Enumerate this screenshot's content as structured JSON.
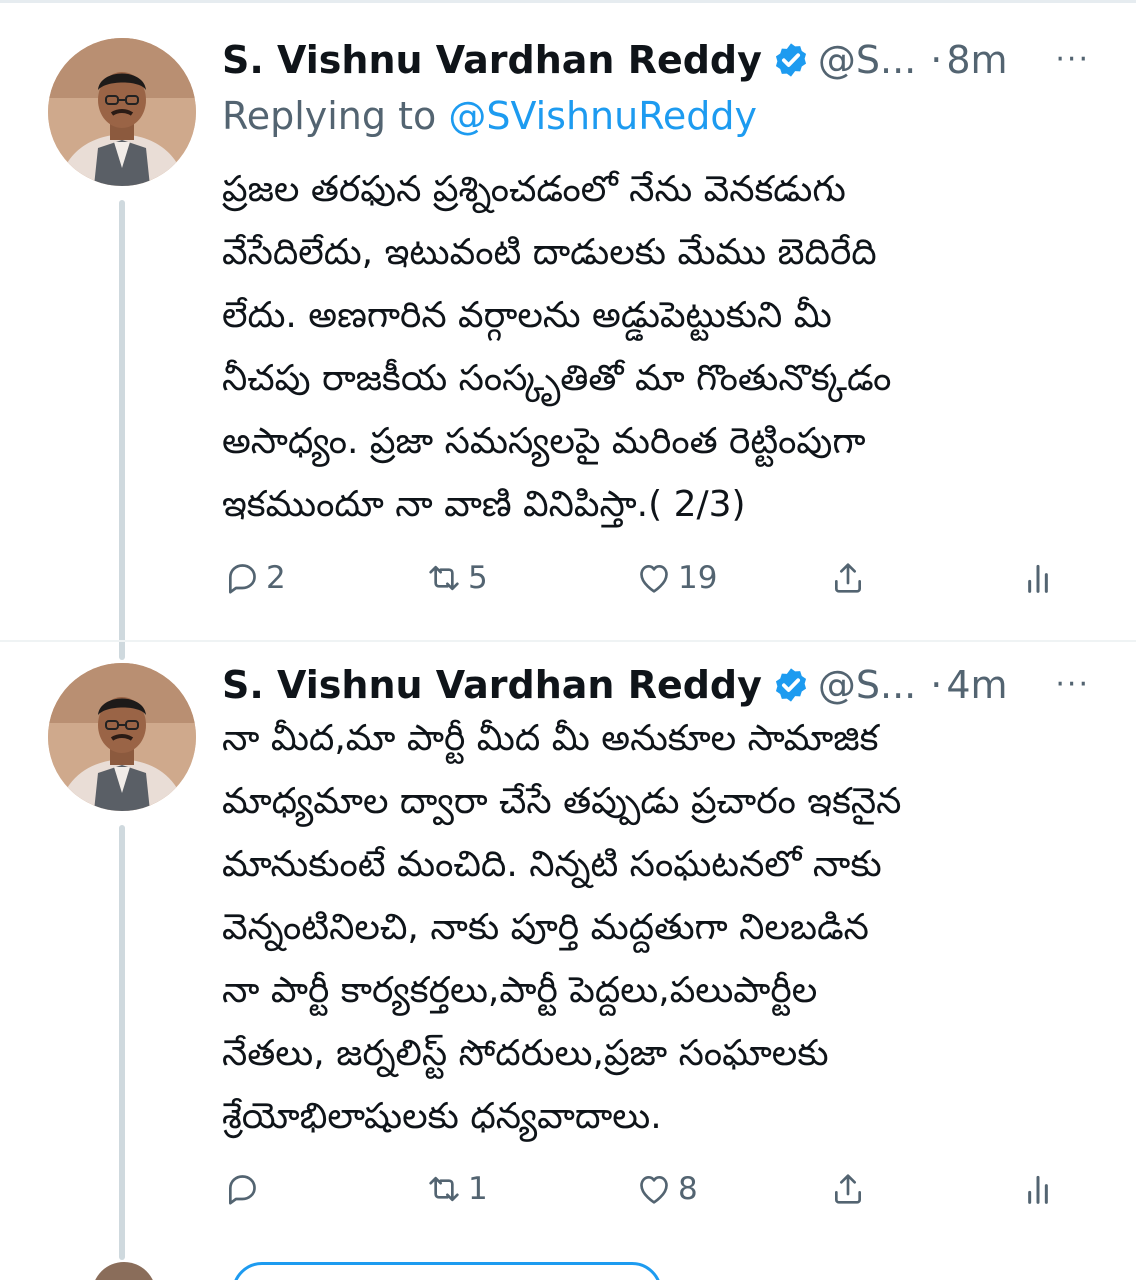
{
  "colors": {
    "accent": "#1d9bf0",
    "secondary_text": "#536471",
    "primary_text": "#0f1419",
    "thread_line": "#cfd9de"
  },
  "tweets": [
    {
      "author_name": "S. Vishnu Vardhan Reddy",
      "verified_icon": "verified-badge-icon",
      "handle": "@S...",
      "dot": "·",
      "time": "8m",
      "more": "···",
      "replying_prefix": "Replying to",
      "replying_to": "@SVishnuReddy",
      "lines": [
        "ప్రజల తరఫున ప్రశ్నించడంలో నేను వెనకడుగు",
        "వేసేదిలేదు, ఇటువంటి దాడులకు మేము బెదిరేది",
        "లేదు. అణగారిన వర్గాలను అడ్డుపెట్టుకుని మీ",
        "నీచపు రాజకీయ సంస్కృతితో మా గొంతునొక్కడం",
        "అసాధ్యం. ప్రజా సమస్యలపై మరింత రెట్టింపుగా",
        "ఇకముందూ నా వాణి వినిపిస్తా.( 2/3)"
      ],
      "actions": {
        "reply_count": "2",
        "retweet_count": "5",
        "like_count": "19"
      }
    },
    {
      "author_name": "S. Vishnu Vardhan Reddy",
      "verified_icon": "verified-badge-icon",
      "handle": "@S...",
      "dot": "·",
      "time": "4m",
      "more": "···",
      "lines": [
        "నా మీద,మా పార్టీ మీద మీ అనుకూల సామాజిక",
        "మాధ్యమాల ద్వారా చేసే తప్పుడు ప్రచారం ఇకనైన",
        "మానుకుంటే మంచిది. నిన్నటి సంఘటనలో నాకు",
        "వెన్నంటినిలచి, నాకు పూర్తి మద్దతుగా నిలబడిన",
        "నా పార్టీ కార్యకర్తలు,పార్టీ పెద్దలు,పలుపార్టీల",
        "నేతలు, జర్నలిస్ట్ సోదరులు,ప్రజా సంఘాలకు",
        "శ్రేయోభిలాషులకు ధన్యవాదాలు."
      ],
      "actions": {
        "reply_count": "",
        "retweet_count": "1",
        "like_count": "8"
      }
    }
  ]
}
